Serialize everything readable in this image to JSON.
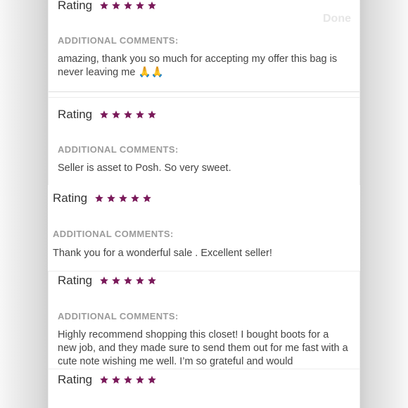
{
  "done_label": "Done",
  "star_color": "#7a1a5a",
  "reviews": [
    {
      "rating_label": "Rating",
      "stars": 5,
      "comments_label": "ADDITIONAL COMMENTS:",
      "comment": "amazing, thank you so much for accepting my offer this bag is never leaving me 🙏🙏"
    },
    {
      "rating_label": "Rating",
      "stars": 5,
      "comments_label": "ADDITIONAL COMMENTS:",
      "comment": "Seller is asset to Posh. So very sweet."
    },
    {
      "rating_label": "Rating",
      "stars": 5,
      "comments_label": "ADDITIONAL COMMENTS:",
      "comment": "Thank you for a wonderful sale . Excellent seller!"
    },
    {
      "rating_label": "Rating",
      "stars": 5,
      "comments_label": "ADDITIONAL COMMENTS:",
      "comment": "Highly recommend shopping this closet! I bought boots for a new job, and they made sure to send them out for me fast with a cute note wishing me well. I’m so grateful and would"
    },
    {
      "rating_label": "Rating",
      "stars": 5
    }
  ]
}
